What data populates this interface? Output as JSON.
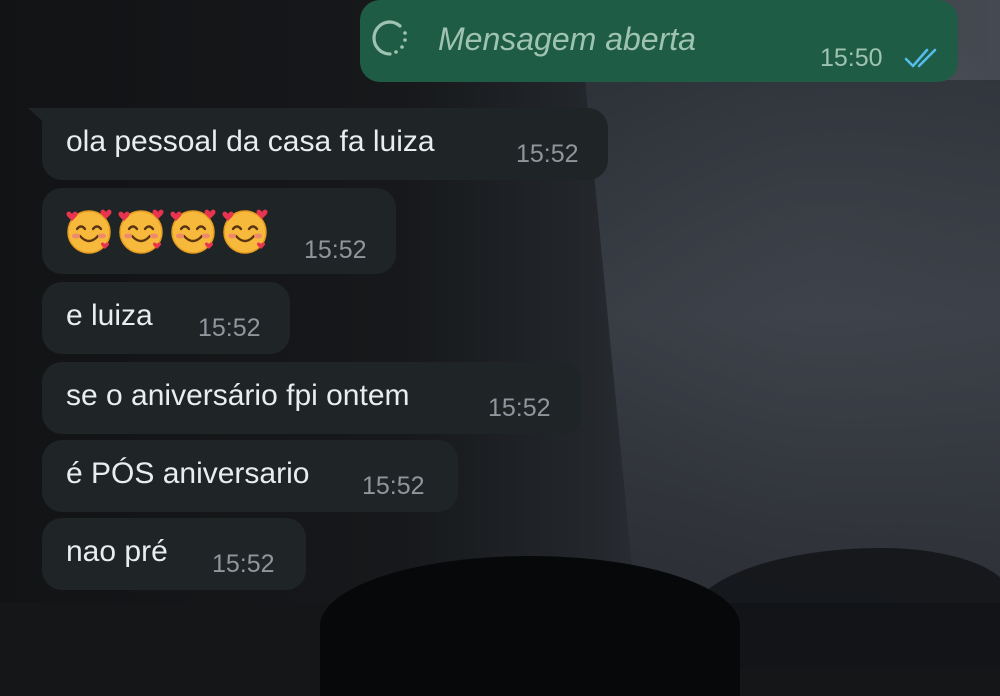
{
  "sent_message": {
    "text": "Mensagem aberta",
    "time": "15:50",
    "status_icon": "double-check-icon",
    "view_icon": "view-once-icon",
    "colors": {
      "bubble": "#1f5c45",
      "text": "#9fc3b3",
      "ticks": "#53bdeb"
    }
  },
  "received_messages": [
    {
      "kind": "text",
      "text": "ola pessoal da casa fa luiza",
      "time": "15:52"
    },
    {
      "kind": "emoji",
      "emoji_name": "smiling-face-with-hearts",
      "emoji_count": 4,
      "time": "15:52"
    },
    {
      "kind": "text",
      "text": "e luiza",
      "time": "15:52"
    },
    {
      "kind": "text",
      "text": "se o aniversário fpi ontem",
      "time": "15:52"
    },
    {
      "kind": "text",
      "text": "é PÓS aniversario",
      "time": "15:52"
    },
    {
      "kind": "text",
      "text": "nao pré",
      "time": "15:52"
    }
  ],
  "colors": {
    "incoming_bubble": "#1f2427",
    "incoming_text": "#e9edef",
    "timestamp": "#8d979c"
  }
}
